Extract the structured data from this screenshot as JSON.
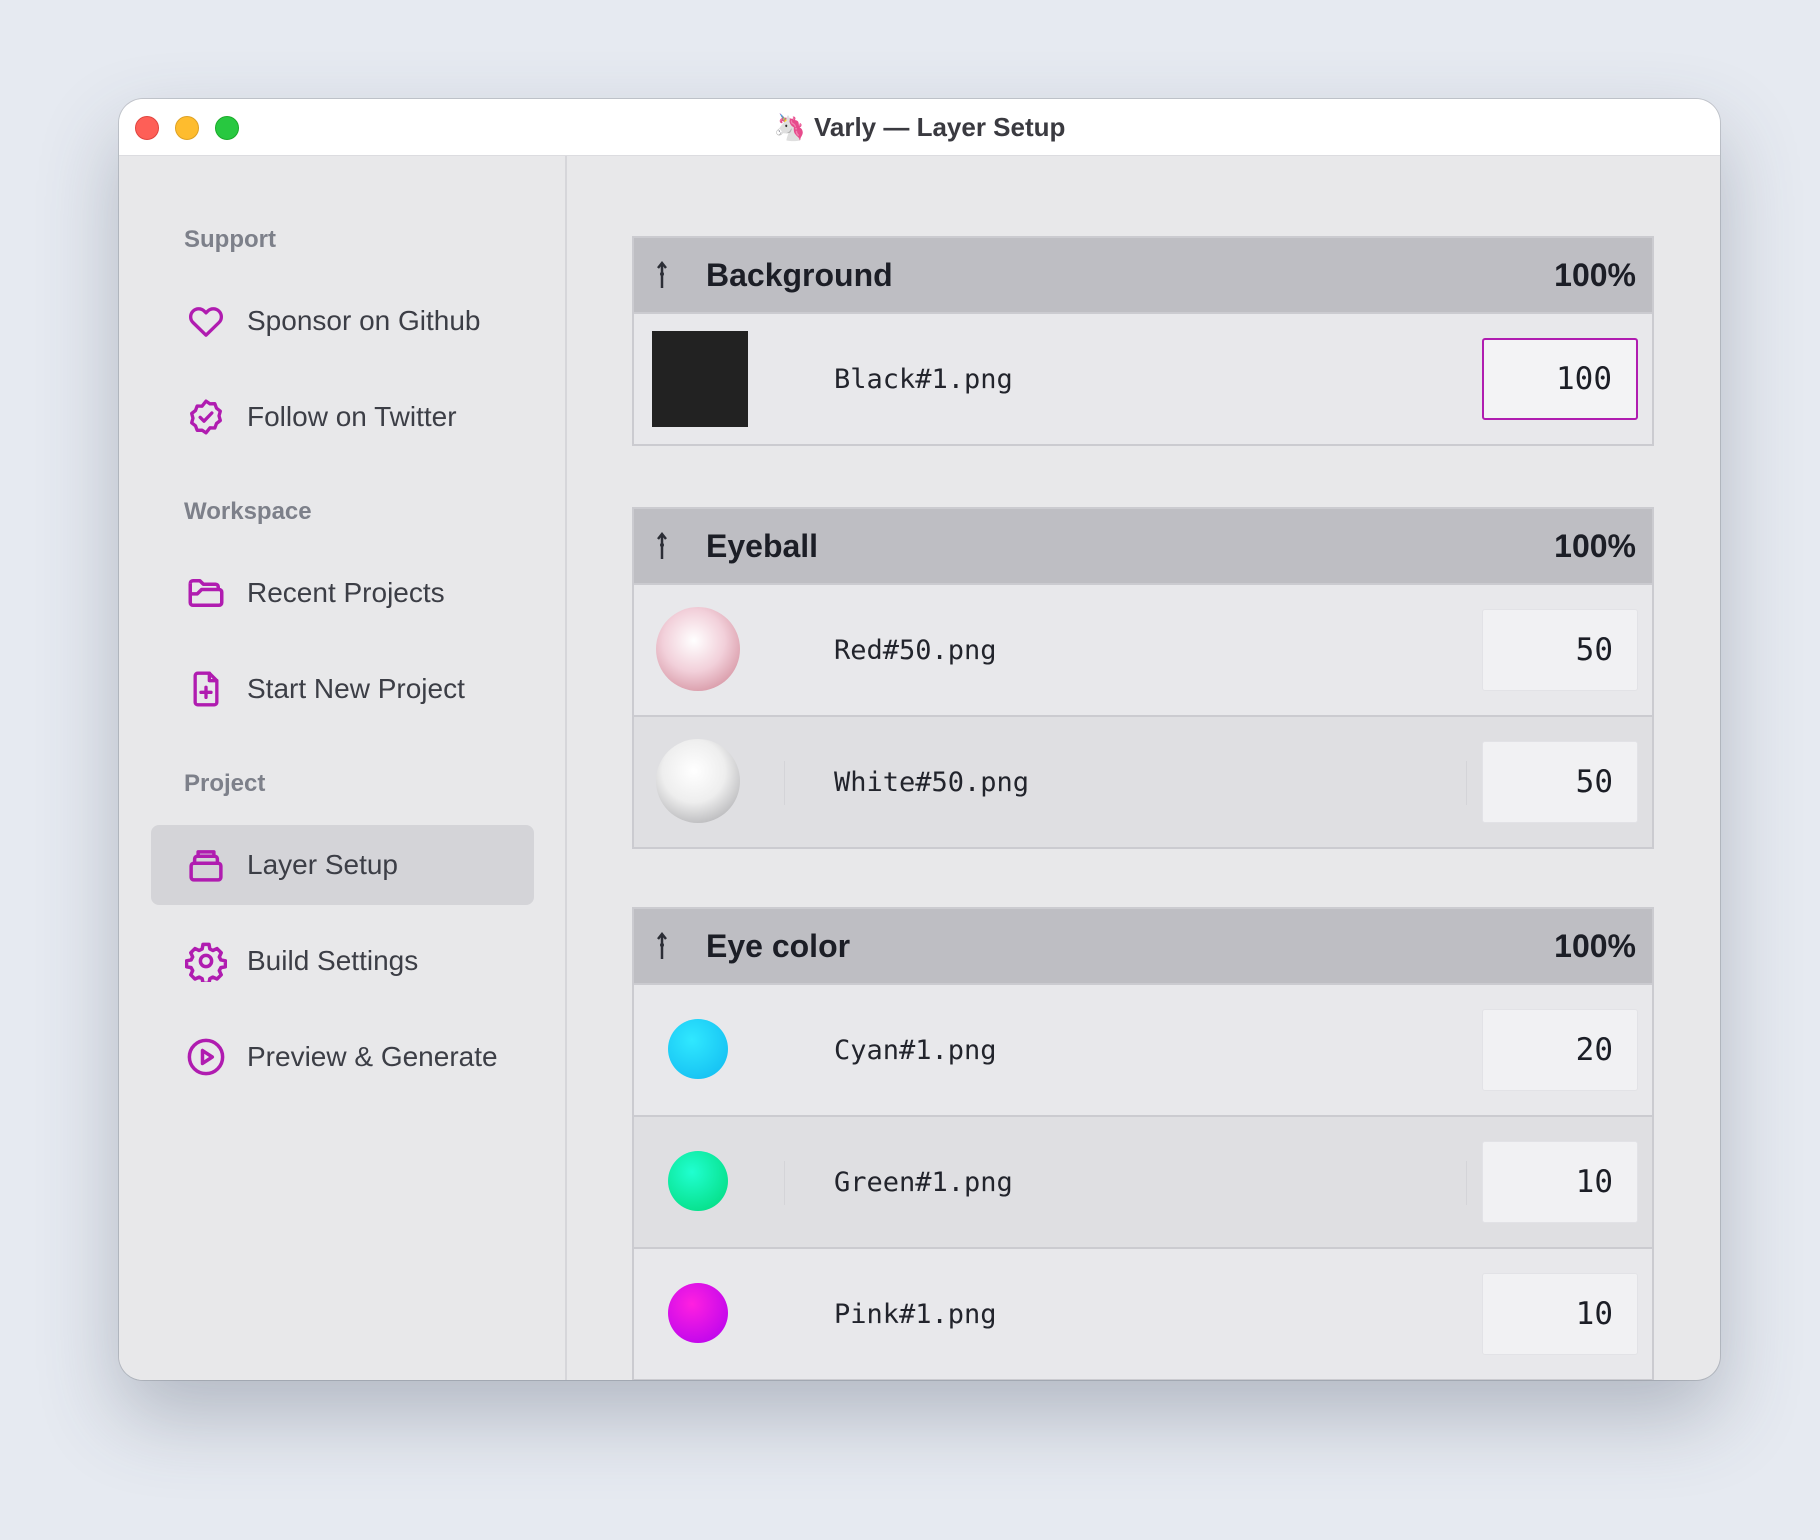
{
  "window": {
    "title": "Varly — Layer Setup",
    "logo": "🦄"
  },
  "colors": {
    "accent": "#b01cb0"
  },
  "sidebar": {
    "sections": [
      {
        "heading": "Support",
        "items": [
          {
            "label": "Sponsor on Github",
            "icon": "heart-icon"
          },
          {
            "label": "Follow on Twitter",
            "icon": "badge-check-icon"
          }
        ]
      },
      {
        "heading": "Workspace",
        "items": [
          {
            "label": "Recent Projects",
            "icon": "folder-icon"
          },
          {
            "label": "Start New Project",
            "icon": "file-plus-icon"
          }
        ]
      },
      {
        "heading": "Project",
        "items": [
          {
            "label": "Layer Setup",
            "icon": "layers-icon",
            "active": true
          },
          {
            "label": "Build Settings",
            "icon": "gear-icon"
          },
          {
            "label": "Preview & Generate",
            "icon": "play-circle-icon"
          }
        ]
      }
    ]
  },
  "layers": [
    {
      "name": "Background",
      "percent": "100%",
      "traits": [
        {
          "file": "Black#1.png",
          "weight": "100",
          "focused": true,
          "color": "#222222"
        }
      ]
    },
    {
      "name": "Eyeball",
      "percent": "100%",
      "traits": [
        {
          "file": "Red#50.png",
          "weight": "50",
          "color": "#e8a8b8"
        },
        {
          "file": "White#50.png",
          "weight": "50",
          "color": "#e0e0e0"
        }
      ]
    },
    {
      "name": "Eye color",
      "percent": "100%",
      "traits": [
        {
          "file": "Cyan#1.png",
          "weight": "20",
          "color": "#22c8f0"
        },
        {
          "file": "Green#1.png",
          "weight": "10",
          "color": "#10e8a0"
        },
        {
          "file": "Pink#1.png",
          "weight": "10",
          "color": "#e010e0"
        }
      ]
    }
  ]
}
